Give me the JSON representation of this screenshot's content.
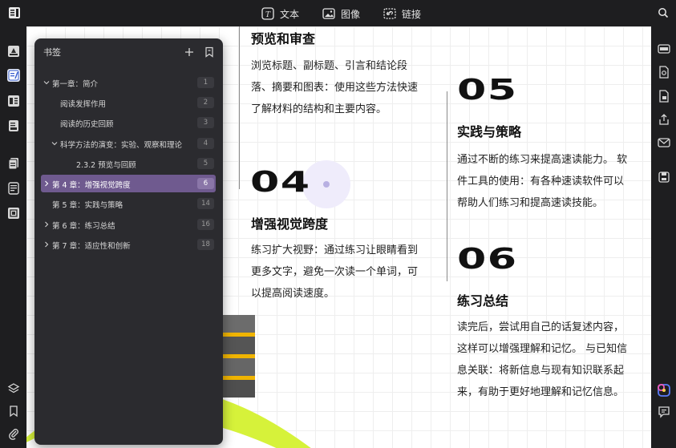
{
  "toolbar": {
    "text_label": "文本",
    "image_label": "图像",
    "link_label": "链接"
  },
  "document": {
    "section_top": {
      "heading": "预览和审查",
      "body": [
        "浏览标题、副标题、引言和结论段",
        "落、摘要和图表：使用这些方法快速",
        "了解材料的结构和主要内容。"
      ]
    },
    "section_04": {
      "number": "04",
      "heading": "增强视觉跨度",
      "body": [
        "练习扩大视野：通过练习让眼睛看到",
        "更多文字，避免一次读一个单词，可",
        "以提高阅读速度。"
      ]
    },
    "section_05": {
      "number": "05",
      "heading": "实践与策略",
      "body": [
        "通过不断的练习来提高速读能力。 软",
        "件工具的使用：有各种速读软件可以",
        "帮助人们练习和提高速读技能。"
      ]
    },
    "section_06": {
      "number": "06",
      "heading": "练习总结",
      "body": [
        "读完后，尝试用自己的话复述内容，",
        "这样可以增强理解和记忆。 与已知信",
        "息关联：将新信息与现有知识联系起",
        "来，有助于更好地理解和记忆信息。"
      ]
    }
  },
  "bookmarks": {
    "title": "书签",
    "items": [
      {
        "label": "第一章：简介",
        "page": "1",
        "expanded": true
      },
      {
        "label": "阅读发挥作用",
        "page": "2"
      },
      {
        "label": "阅读的历史回顾",
        "page": "3"
      },
      {
        "label": "科学方法的演变：实验、观察和理论",
        "page": "4",
        "expanded": true
      },
      {
        "label": "2.3.2 预览与回顾",
        "page": "5"
      },
      {
        "label": "第 4 章：增强视觉跨度",
        "page": "6",
        "selected": true
      },
      {
        "label": "第 5 章：实践与策略",
        "page": "14"
      },
      {
        "label": "第 6 章：练习总结",
        "page": "16"
      },
      {
        "label": "第 7 章：适应性和创新",
        "page": "18"
      }
    ]
  },
  "colors": {
    "selected_row": "#6f5a8f",
    "accent_green": "#d6f23a",
    "panel_bg": "#2b2b2f"
  }
}
